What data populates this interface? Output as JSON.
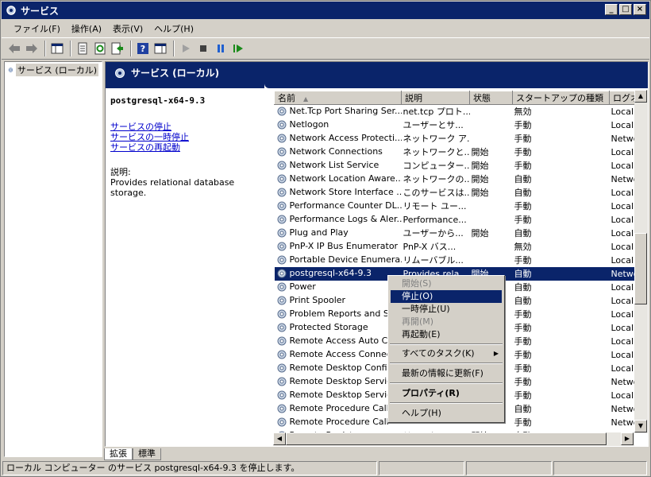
{
  "window": {
    "title": "サービス",
    "min_label": "_",
    "max_label": "□",
    "close_label": "×"
  },
  "menu": [
    "ファイル(F)",
    "操作(A)",
    "表示(V)",
    "ヘルプ(H)"
  ],
  "tree": {
    "root": "サービス (ローカル)"
  },
  "header": {
    "title": "サービス (ローカル)"
  },
  "info": {
    "service_name": "postgresql-x64-9.3",
    "link_stop": "サービスの停止",
    "link_pause": "サービスの一時停止",
    "link_restart": "サービスの再起動",
    "desc_label": "説明:",
    "desc_text": "Provides relational database storage."
  },
  "table": {
    "columns": [
      "名前",
      "説明",
      "状態",
      "スタートアップの種類",
      "ログオン"
    ],
    "rows": [
      [
        "Net.Tcp Port Sharing Ser...",
        "net.tcp プロト...",
        "",
        "無効",
        "Local"
      ],
      [
        "Netlogon",
        "ユーザーとサ...",
        "",
        "手動",
        "Local"
      ],
      [
        "Network Access Protecti...",
        "ネットワーク ア...",
        "",
        "手動",
        "Netwo"
      ],
      [
        "Network Connections",
        "ネットワークと...",
        "開始",
        "手動",
        "Local"
      ],
      [
        "Network List Service",
        "コンピューター...",
        "開始",
        "手動",
        "Local"
      ],
      [
        "Network Location Aware...",
        "ネットワークの...",
        "開始",
        "自動",
        "Netwo"
      ],
      [
        "Network Store Interface ...",
        "このサービスは...",
        "開始",
        "自動",
        "Local"
      ],
      [
        "Performance Counter DL...",
        "リモート ユー...",
        "",
        "手動",
        "Local"
      ],
      [
        "Performance Logs & Aler...",
        "Performance...",
        "",
        "手動",
        "Local"
      ],
      [
        "Plug and Play",
        "ユーザーから...",
        "開始",
        "自動",
        "Local"
      ],
      [
        "PnP-X IP Bus Enumerator",
        "PnP-X バス...",
        "",
        "無効",
        "Local"
      ],
      [
        "Portable Device Enumera...",
        "リムーバブル...",
        "",
        "手動",
        "Local"
      ],
      [
        "postgresql-x64-9.3",
        "Provides rela...",
        "開始",
        "自動",
        "Netwo"
      ],
      [
        "Power",
        "",
        "",
        "自動",
        "Local"
      ],
      [
        "Print Spooler",
        "",
        "",
        "自動",
        "Local"
      ],
      [
        "Problem Reports and So",
        "",
        "",
        "手動",
        "Local"
      ],
      [
        "Protected Storage",
        "",
        "",
        "手動",
        "Local"
      ],
      [
        "Remote Access Auto Co",
        "",
        "",
        "手動",
        "Local"
      ],
      [
        "Remote Access Connec",
        "",
        "",
        "手動",
        "Local"
      ],
      [
        "Remote Desktop Config",
        "",
        "",
        "手動",
        "Local"
      ],
      [
        "Remote Desktop Service",
        "",
        "",
        "手動",
        "Netwo"
      ],
      [
        "Remote Desktop Service",
        "",
        "",
        "手動",
        "Local"
      ],
      [
        "Remote Procedure Call",
        "",
        "",
        "自動",
        "Netwo"
      ],
      [
        "Remote Procedure Call",
        "",
        "",
        "手動",
        "Netwo"
      ],
      [
        "Remote Registry",
        "リモート ユ...",
        "開始",
        "自動",
        "Local"
      ]
    ],
    "selected_index": 12
  },
  "context_menu": {
    "start": "開始(S)",
    "stop": "停止(O)",
    "pause": "一時停止(U)",
    "resume": "再開(M)",
    "restart": "再起動(E)",
    "all_tasks": "すべてのタスク(K)",
    "refresh": "最新の情報に更新(F)",
    "properties": "プロパティ(R)",
    "help": "ヘルプ(H)"
  },
  "tabs": [
    "拡張",
    "標準"
  ],
  "status": {
    "text": "ローカル コンピューター のサービス postgresql-x64-9.3 を停止します。"
  }
}
